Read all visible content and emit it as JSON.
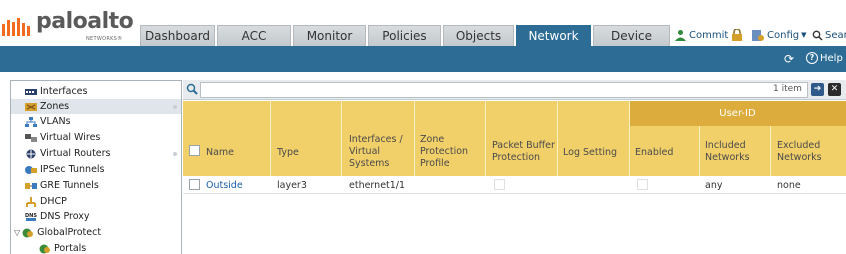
{
  "brand": {
    "name": "paloalto",
    "sub": "NETWORKS®"
  },
  "tabs": [
    {
      "label": "Dashboard",
      "active": false
    },
    {
      "label": "ACC",
      "active": false
    },
    {
      "label": "Monitor",
      "active": false
    },
    {
      "label": "Policies",
      "active": false
    },
    {
      "label": "Objects",
      "active": false
    },
    {
      "label": "Network",
      "active": true
    },
    {
      "label": "Device",
      "active": false
    }
  ],
  "tools": {
    "commit": "Commit",
    "config": "Config",
    "search": "Sear"
  },
  "bluebar": {
    "help": "Help"
  },
  "sidebar": {
    "items": [
      {
        "label": "Interfaces",
        "icon": "interfaces-icon"
      },
      {
        "label": "Zones",
        "icon": "zones-icon",
        "selected": true
      },
      {
        "label": "VLANs",
        "icon": "vlans-icon"
      },
      {
        "label": "Virtual Wires",
        "icon": "virtual-wires-icon"
      },
      {
        "label": "Virtual Routers",
        "icon": "virtual-routers-icon"
      },
      {
        "label": "IPSec Tunnels",
        "icon": "ipsec-tunnels-icon"
      },
      {
        "label": "GRE Tunnels",
        "icon": "gre-tunnels-icon"
      },
      {
        "label": "DHCP",
        "icon": "dhcp-icon"
      },
      {
        "label": "DNS Proxy",
        "icon": "dns-proxy-icon"
      },
      {
        "label": "GlobalProtect",
        "icon": "globalprotect-icon"
      },
      {
        "label": "Portals",
        "icon": "portals-icon"
      }
    ]
  },
  "filter": {
    "item_count": "1 item"
  },
  "table": {
    "group_header": "User-ID",
    "headers": {
      "name": "Name",
      "type": "Type",
      "interfaces": [
        "Interfaces /",
        "Virtual",
        "Systems"
      ],
      "zone_protection": [
        "Zone",
        "Protection",
        "Profile"
      ],
      "packet_buffer": [
        "Packet Buffer",
        "Protection"
      ],
      "log_setting": "Log Setting",
      "enabled": "Enabled",
      "included": [
        "Included",
        "Networks"
      ],
      "excluded": [
        "Excluded",
        "Networks"
      ]
    },
    "rows": [
      {
        "name": "Outside",
        "type": "layer3",
        "interfaces": "ethernet1/1",
        "zone_protection": "",
        "packet_buffer": false,
        "log_setting": "",
        "enabled": false,
        "included": "any",
        "excluded": "none"
      }
    ]
  },
  "colors": {
    "accent": "#2d6d95",
    "header_yellow": "#f1d06a",
    "group_yellow": "#dcac3c",
    "link": "#1a5ea8"
  }
}
